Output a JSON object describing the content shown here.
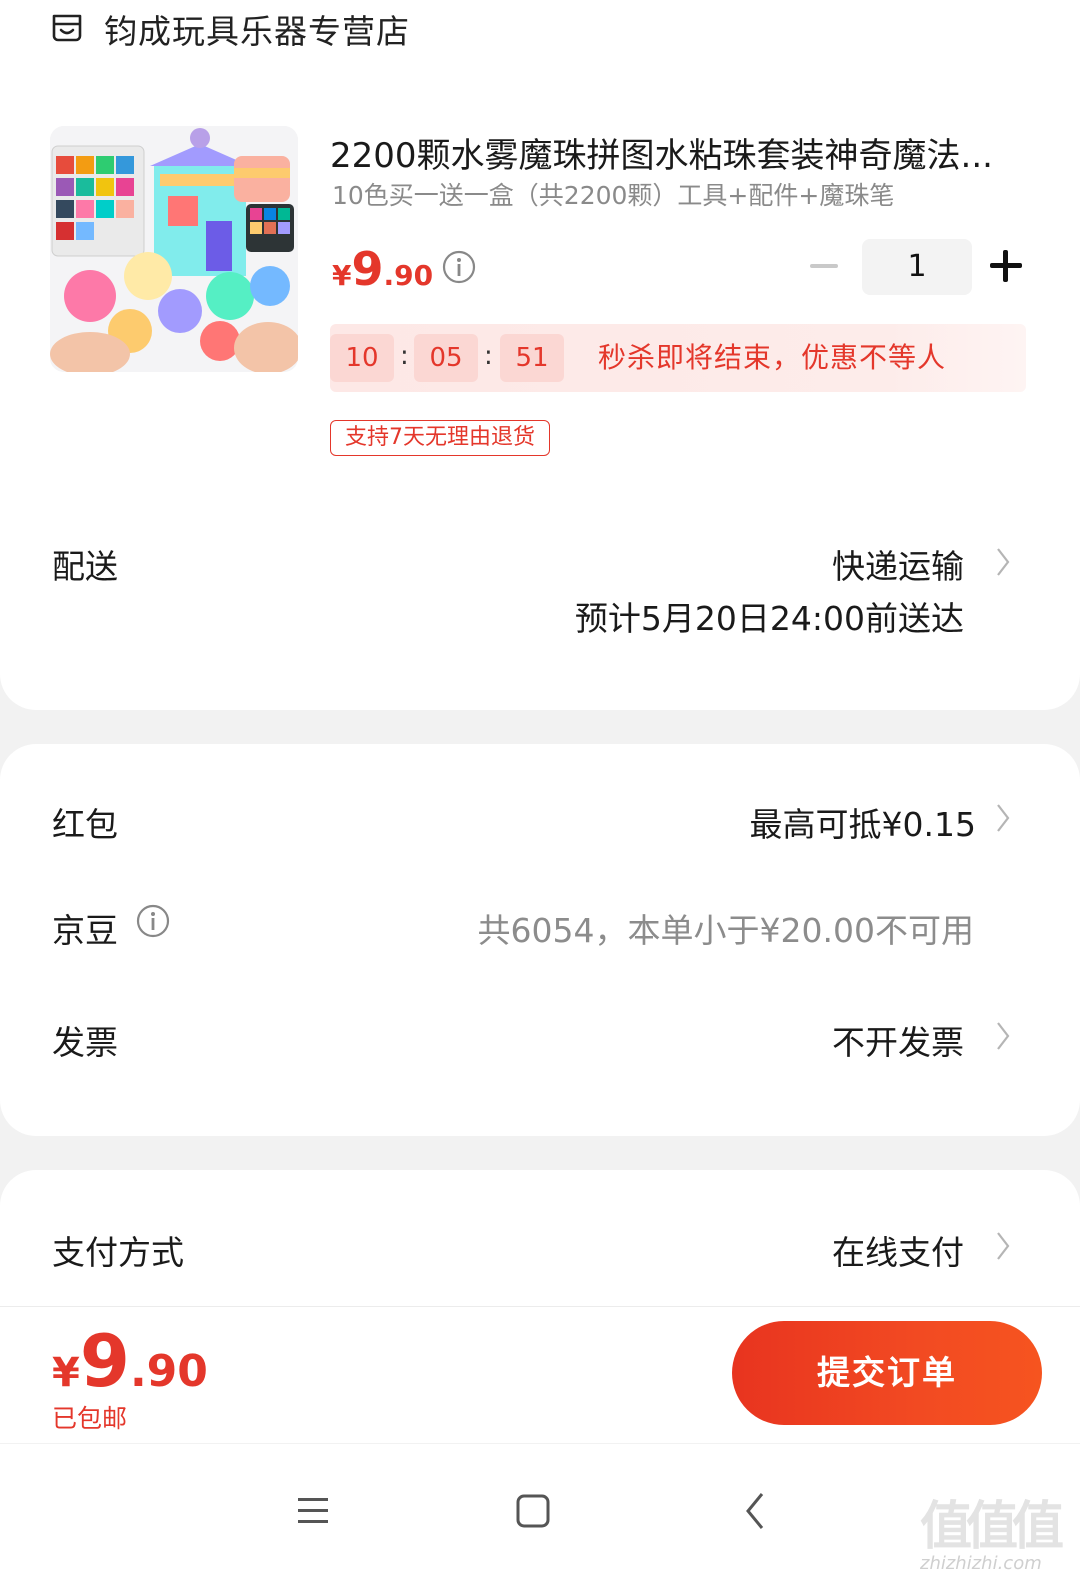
{
  "store": {
    "name": "钧成玩具乐器专营店"
  },
  "product": {
    "title": "2200颗水雾魔珠拼图水粘珠套装神奇魔法...",
    "spec": "10色买一送一盒（共2200颗）工具+配件+魔珠笔",
    "price": {
      "symbol": "¥",
      "integer": "9",
      "decimal": ".90"
    },
    "quantity": "1",
    "countdown": {
      "hours": "10",
      "minutes": "05",
      "seconds": "51",
      "sep": ":"
    },
    "seckill_text": "秒杀即将结束，优惠不等人",
    "return_policy": "支持7天无理由退货"
  },
  "delivery": {
    "label": "配送",
    "method": "快递运输",
    "eta": "预计5月20日24:00前送达"
  },
  "discounts": {
    "red_packet": {
      "label": "红包",
      "value": "最高可抵¥0.15"
    },
    "jingdou": {
      "label": "京豆",
      "value": "共6054，本单小于¥20.00不可用"
    },
    "invoice": {
      "label": "发票",
      "value": "不开发票"
    }
  },
  "payment": {
    "label": "支付方式",
    "value": "在线支付"
  },
  "footer": {
    "total": {
      "symbol": "¥",
      "integer": "9",
      "decimal": ".90"
    },
    "shipping_note": "已包邮",
    "submit_label": "提交订单"
  },
  "watermark": {
    "glyphs": "值值值",
    "site": "zhizhizhi.com"
  },
  "colors": {
    "accent": "#e4372b",
    "button": "#f04523",
    "background": "#f2f2f2"
  }
}
